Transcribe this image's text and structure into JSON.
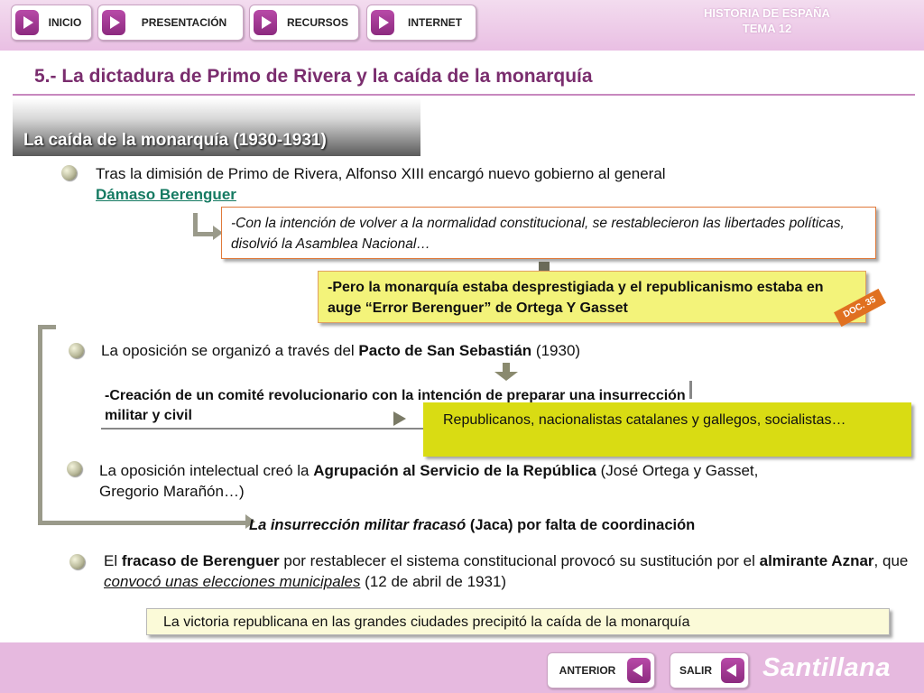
{
  "colors": {
    "accent": "#7a2d6e",
    "header_bg": "#e9bfe3",
    "link": "#157a62"
  },
  "nav": {
    "items": [
      {
        "label": "INICIO",
        "icon": "play-arrow-icon"
      },
      {
        "label": "PRESENTACIÓN",
        "icon": "play-arrow-icon"
      },
      {
        "label": "RECURSOS",
        "icon": "play-arrow-icon"
      },
      {
        "label": "INTERNET",
        "icon": "play-arrow-icon"
      }
    ]
  },
  "brand": {
    "line1": "HISTORIA DE ESPAÑA",
    "line2": "TEMA 12"
  },
  "page_title": "5.- La dictadura de Primo de Rivera y la caída de la monarquía",
  "section_title": "La caída de la monarquía (1930-1931)",
  "p1": {
    "text": "Tras la dimisión de Primo de Rivera, Alfonso XIII encargó nuevo gobierno al general",
    "link": "Dámaso Berenguer"
  },
  "box1": {
    "text": "-Con la intención de volver a la normalidad constitucional, se restablecieron las libertades políticas, disolvió la Asamblea Nacional…"
  },
  "box2": {
    "dash": "-",
    "text": "Pero la monarquía estaba desprestigiada y el republicanismo estaba en auge “Error Berenguer” de Ortega Y Gasset",
    "doc_tag": "DOC. 35"
  },
  "p2": {
    "pre": "La oposición se organizó a través del ",
    "bold": "Pacto de San Sebastián",
    "post": " (1930)"
  },
  "p2_sub": {
    "dash": "-",
    "text": "Creación de un comité revolucionario con la intención de preparar una insurrección militar y civil"
  },
  "box3": {
    "text": "Republicanos, nacionalistas catalanes y gallegos, socialistas…"
  },
  "p3": {
    "pre": "La oposición intelectual creó la ",
    "bold": "Agrupación al Servicio de la República",
    "post": " (José Ortega y Gasset, Gregorio Marañón…)"
  },
  "p3_result": {
    "italic": "La insurrección militar fracasó",
    "post": " (Jaca) por falta de coordinación"
  },
  "p4": {
    "pre": "El ",
    "bold1": "fracaso de Berenguer",
    "mid1": " por restablecer el sistema constitucional provocó su sustitución por el ",
    "bold2": "almirante Aznar",
    "mid2": ", que ",
    "underlined": "convocó unas elecciones municipales",
    "post": " (12 de abril de 1931)"
  },
  "box4": {
    "text": "La victoria republicana en las grandes ciudades precipitó la caída de la monarquía"
  },
  "footer": {
    "prev_label": "ANTERIOR",
    "exit_label": "SALIR",
    "logo": "Santillana"
  }
}
